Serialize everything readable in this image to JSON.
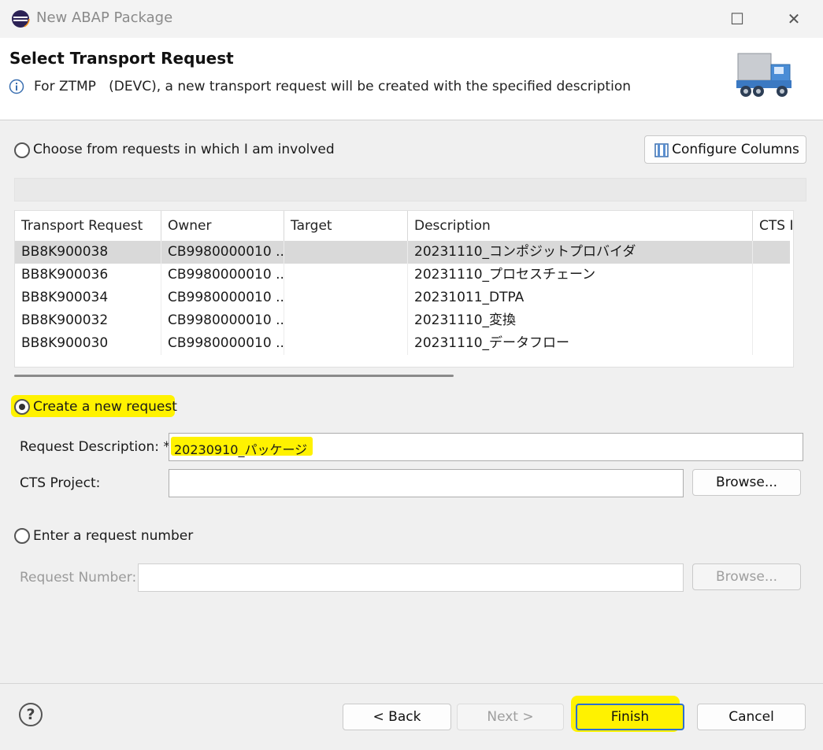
{
  "window": {
    "title": "New ABAP Package",
    "maximize_symbol": "☐",
    "close_symbol": "✕"
  },
  "header": {
    "title": "Select Transport Request",
    "message": "For ZTMP   (DEVC), a new transport request will be created with the specified description"
  },
  "choose": {
    "label": "Choose from requests in which I am involved",
    "configure_label": "Configure Columns",
    "selected": false
  },
  "table": {
    "columns": [
      "Transport Request",
      "Owner",
      "Target",
      "Description",
      "CTS I"
    ],
    "rows": [
      [
        "BB8K900038",
        "CB9980000010 ...",
        "",
        "20231110_コンポジットプロバイダ",
        ""
      ],
      [
        "BB8K900036",
        "CB9980000010 ...",
        "",
        "20231110_プロセスチェーン",
        ""
      ],
      [
        "BB8K900034",
        "CB9980000010 ...",
        "",
        "20231011_DTPA",
        ""
      ],
      [
        "BB8K900032",
        "CB9980000010 ...",
        "",
        "20231110_変換",
        ""
      ],
      [
        "BB8K900030",
        "CB9980000010 ...",
        "",
        "20231110_データフロー",
        ""
      ]
    ]
  },
  "create": {
    "label": "Create a new request",
    "selected": true,
    "desc_label": "Request Description: *",
    "desc_value": "20230910_パッケージ",
    "cts_label": "CTS Project:",
    "cts_value": "",
    "browse_label": "Browse..."
  },
  "enter": {
    "label": "Enter a request number",
    "selected": false,
    "number_label": "Request Number:",
    "number_value": "",
    "browse_label": "Browse..."
  },
  "footer": {
    "help_symbol": "?",
    "back_label": "< Back",
    "next_label": "Next >",
    "finish_label": "Finish",
    "cancel_label": "Cancel"
  },
  "colors": {
    "highlight": "#fff200",
    "selected_row": "#d9d9d9"
  },
  "icons": [
    "info-icon",
    "truck-icon",
    "columns-icon",
    "help-icon",
    "app-icon"
  ]
}
